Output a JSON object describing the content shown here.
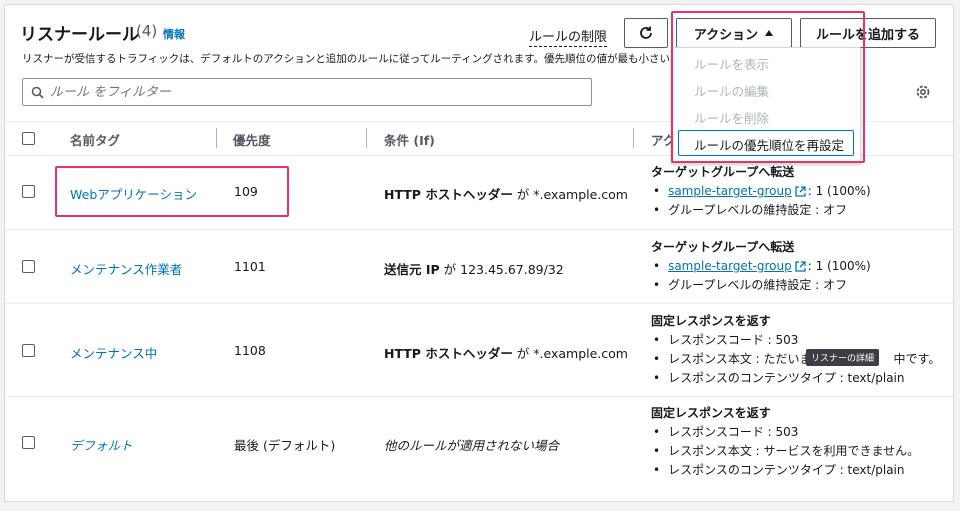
{
  "header": {
    "title": "リスナールール",
    "count": "(4)",
    "info": "情報",
    "description": "リスナーが受信するトラフィックは、デフォルトのアクションと追加のルールに従ってルーティングされます。優先順位の値が最も小さい",
    "limit_link": "ルールの制限",
    "action_button": "アクション",
    "add_rule_button": "ルールを追加する"
  },
  "search": {
    "placeholder": "ルール をフィルター"
  },
  "columns": [
    "名前タグ",
    "優先度",
    "条件 (If)",
    "アク"
  ],
  "action_menu": {
    "items": [
      "ルールを表示",
      "ルールの編集",
      "ルールを削除"
    ],
    "active_item": "ルールの優先順位を再設定"
  },
  "rows": [
    {
      "name": "Webアプリケーション",
      "priority": "109",
      "condition_bold": "HTTP ホストヘッダー",
      "condition_rest": " が *.example.com",
      "action_title": "ターゲットグループへ転送",
      "action_items": [
        "sample-target-group",
        "グループレベルの維持設定 : オフ"
      ],
      "target_suffix": ": 1 (100%)"
    },
    {
      "name": "メンテナンス作業者",
      "priority": "1101",
      "condition_bold": "送信元 IP",
      "condition_rest": " が 123.45.67.89/32",
      "action_title": "ターゲットグループへ転送",
      "action_items": [
        "sample-target-group",
        "グループレベルの維持設定 : オフ"
      ],
      "target_suffix": ": 1 (100%)"
    },
    {
      "name": "メンテナンス中",
      "priority": "1108",
      "condition_bold": "HTTP ホストヘッダー",
      "condition_rest": " が *.example.com",
      "action_title": "固定レスポンスを返す",
      "action_items": [
        "レスポンスコード : 503",
        "レスポンス本文 : ただいま",
        "レスポンスのコンテンツタイプ : text/plain"
      ],
      "body_tail": "中です。"
    },
    {
      "name": "デフォルト",
      "priority": "最後 (デフォルト)",
      "condition_italic": "他のルールが適用されない場合",
      "action_title": "固定レスポンスを返す",
      "action_items": [
        "レスポンスコード : 503",
        "レスポンス本文 : サービスを利用できません。",
        "レスポンスのコンテンツタイプ : text/plain"
      ]
    }
  ],
  "tooltip": "リスナーの詳細",
  "colors": {
    "link": "#0073bb",
    "highlight": "#e8336a",
    "border": "#545b64"
  }
}
